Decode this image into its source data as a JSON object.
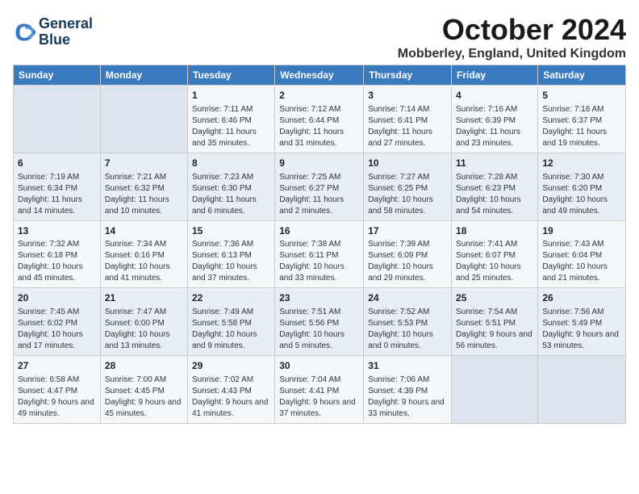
{
  "logo": {
    "line1": "General",
    "line2": "Blue"
  },
  "title": "October 2024",
  "location": "Mobberley, England, United Kingdom",
  "days_header": [
    "Sunday",
    "Monday",
    "Tuesday",
    "Wednesday",
    "Thursday",
    "Friday",
    "Saturday"
  ],
  "weeks": [
    [
      {
        "day": "",
        "info": ""
      },
      {
        "day": "",
        "info": ""
      },
      {
        "day": "1",
        "info": "Sunrise: 7:11 AM\nSunset: 6:46 PM\nDaylight: 11 hours and 35 minutes."
      },
      {
        "day": "2",
        "info": "Sunrise: 7:12 AM\nSunset: 6:44 PM\nDaylight: 11 hours and 31 minutes."
      },
      {
        "day": "3",
        "info": "Sunrise: 7:14 AM\nSunset: 6:41 PM\nDaylight: 11 hours and 27 minutes."
      },
      {
        "day": "4",
        "info": "Sunrise: 7:16 AM\nSunset: 6:39 PM\nDaylight: 11 hours and 23 minutes."
      },
      {
        "day": "5",
        "info": "Sunrise: 7:18 AM\nSunset: 6:37 PM\nDaylight: 11 hours and 19 minutes."
      }
    ],
    [
      {
        "day": "6",
        "info": "Sunrise: 7:19 AM\nSunset: 6:34 PM\nDaylight: 11 hours and 14 minutes."
      },
      {
        "day": "7",
        "info": "Sunrise: 7:21 AM\nSunset: 6:32 PM\nDaylight: 11 hours and 10 minutes."
      },
      {
        "day": "8",
        "info": "Sunrise: 7:23 AM\nSunset: 6:30 PM\nDaylight: 11 hours and 6 minutes."
      },
      {
        "day": "9",
        "info": "Sunrise: 7:25 AM\nSunset: 6:27 PM\nDaylight: 11 hours and 2 minutes."
      },
      {
        "day": "10",
        "info": "Sunrise: 7:27 AM\nSunset: 6:25 PM\nDaylight: 10 hours and 58 minutes."
      },
      {
        "day": "11",
        "info": "Sunrise: 7:28 AM\nSunset: 6:23 PM\nDaylight: 10 hours and 54 minutes."
      },
      {
        "day": "12",
        "info": "Sunrise: 7:30 AM\nSunset: 6:20 PM\nDaylight: 10 hours and 49 minutes."
      }
    ],
    [
      {
        "day": "13",
        "info": "Sunrise: 7:32 AM\nSunset: 6:18 PM\nDaylight: 10 hours and 45 minutes."
      },
      {
        "day": "14",
        "info": "Sunrise: 7:34 AM\nSunset: 6:16 PM\nDaylight: 10 hours and 41 minutes."
      },
      {
        "day": "15",
        "info": "Sunrise: 7:36 AM\nSunset: 6:13 PM\nDaylight: 10 hours and 37 minutes."
      },
      {
        "day": "16",
        "info": "Sunrise: 7:38 AM\nSunset: 6:11 PM\nDaylight: 10 hours and 33 minutes."
      },
      {
        "day": "17",
        "info": "Sunrise: 7:39 AM\nSunset: 6:09 PM\nDaylight: 10 hours and 29 minutes."
      },
      {
        "day": "18",
        "info": "Sunrise: 7:41 AM\nSunset: 6:07 PM\nDaylight: 10 hours and 25 minutes."
      },
      {
        "day": "19",
        "info": "Sunrise: 7:43 AM\nSunset: 6:04 PM\nDaylight: 10 hours and 21 minutes."
      }
    ],
    [
      {
        "day": "20",
        "info": "Sunrise: 7:45 AM\nSunset: 6:02 PM\nDaylight: 10 hours and 17 minutes."
      },
      {
        "day": "21",
        "info": "Sunrise: 7:47 AM\nSunset: 6:00 PM\nDaylight: 10 hours and 13 minutes."
      },
      {
        "day": "22",
        "info": "Sunrise: 7:49 AM\nSunset: 5:58 PM\nDaylight: 10 hours and 9 minutes."
      },
      {
        "day": "23",
        "info": "Sunrise: 7:51 AM\nSunset: 5:56 PM\nDaylight: 10 hours and 5 minutes."
      },
      {
        "day": "24",
        "info": "Sunrise: 7:52 AM\nSunset: 5:53 PM\nDaylight: 10 hours and 0 minutes."
      },
      {
        "day": "25",
        "info": "Sunrise: 7:54 AM\nSunset: 5:51 PM\nDaylight: 9 hours and 56 minutes."
      },
      {
        "day": "26",
        "info": "Sunrise: 7:56 AM\nSunset: 5:49 PM\nDaylight: 9 hours and 53 minutes."
      }
    ],
    [
      {
        "day": "27",
        "info": "Sunrise: 6:58 AM\nSunset: 4:47 PM\nDaylight: 9 hours and 49 minutes."
      },
      {
        "day": "28",
        "info": "Sunrise: 7:00 AM\nSunset: 4:45 PM\nDaylight: 9 hours and 45 minutes."
      },
      {
        "day": "29",
        "info": "Sunrise: 7:02 AM\nSunset: 4:43 PM\nDaylight: 9 hours and 41 minutes."
      },
      {
        "day": "30",
        "info": "Sunrise: 7:04 AM\nSunset: 4:41 PM\nDaylight: 9 hours and 37 minutes."
      },
      {
        "day": "31",
        "info": "Sunrise: 7:06 AM\nSunset: 4:39 PM\nDaylight: 9 hours and 33 minutes."
      },
      {
        "day": "",
        "info": ""
      },
      {
        "day": "",
        "info": ""
      }
    ]
  ]
}
